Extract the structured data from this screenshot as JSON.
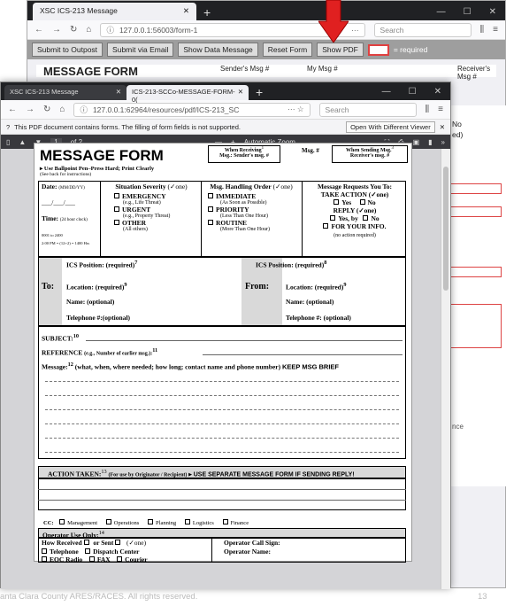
{
  "back_window": {
    "tab_title": "XSC ICS-213 Message",
    "url": "127.0.0.1:56003/form-1",
    "search_placeholder": "Search",
    "buttons": [
      "Submit to Outpost",
      "Submit via Email",
      "Show Data Message",
      "Reset Form",
      "Show PDF"
    ],
    "required_legend": "= required",
    "form_title": "MESSAGE FORM",
    "col_sender": "Sender's Msg #",
    "col_my": "My Msg #",
    "col_receiver": "Receiver's Msg #",
    "sup_sender": "2",
    "sup_receiver": "3",
    "side_no": "No",
    "side_d": "ed)",
    "side_nce": "nce"
  },
  "front_window": {
    "tab1": "XSC ICS-213 Message",
    "tab2": "ICS-213-SCCo-MESSAGE-FORM-0(",
    "url": "127.0.0.1:62964/resources/pdf/ICS-213_SC",
    "search_placeholder": "Search",
    "notice": "This PDF document contains forms. The filling of form fields is not supported.",
    "open_button": "Open With Different Viewer",
    "page_num": "1",
    "page_total": "of 2",
    "zoom": "Automatic Zoom"
  },
  "pdf": {
    "title": "MESSAGE FORM",
    "sub1": "▸ Use Ballpoint Pen–Press Hard; Print Clearly",
    "sub2": "(See back for instructions)",
    "recv_label": "When Receiving",
    "recv_sup": "1",
    "recv_sub": "Msg.: Sender's msg. #",
    "msg_label": "Msg. #",
    "send_label": "When Sending Msg.",
    "send_sup": "3",
    "send_sub": "Receiver's msg. #",
    "date_label": "Date:",
    "date_fmt": "(MM/DD/YY)",
    "date_sup": "4",
    "date_blank": "___/___/___",
    "time_label": "Time:",
    "time_fmt": "(24 hour clock)",
    "time_note1": "0001 to 2400",
    "time_note2": "2:00 PM = (12+2) = 1400 Hrs",
    "sev_title": "Situation Severity",
    "sev_hint": "(✓one)",
    "sev_sup": "4",
    "sev": [
      {
        "l": "EMERGENCY",
        "s": "(e.g., Life Threat)"
      },
      {
        "l": "URGENT",
        "s": "(e.g., Property Threat)"
      },
      {
        "l": "OTHER",
        "s": "(All others)"
      }
    ],
    "hand_title": "Msg. Handling Order",
    "hand_hint": "(✓one)",
    "hand_sup": "5",
    "hand": [
      {
        "l": "IMMEDIATE",
        "s": "(As Soon as Possible)"
      },
      {
        "l": "PRIORITY",
        "s": "(Less Than One Hour)"
      },
      {
        "l": "ROUTINE",
        "s": "(More Than One Hour)"
      }
    ],
    "req_title": "Message Requests You To:",
    "req_sup": "6",
    "req1": "TAKE ACTION (✓one)",
    "req_yes": "Yes",
    "req_no": "No",
    "req2": "REPLY (✓one)",
    "req_yesby": "Yes, by",
    "req3": "FOR YOUR INFO.",
    "req3s": "(no action required)",
    "to_label": "To:",
    "from_label": "From:",
    "ics_to": "ICS Position: (required)",
    "ics_to_sup": "7",
    "ics_from": "ICS Position: (required)",
    "ics_from_sup": "8",
    "loc_to": "Location: (required)",
    "loc_sup": "9",
    "loc_from": "Location: (required)",
    "name": "Name: (optional)",
    "tel_to": "Telephone #:(optional)",
    "tel_from": "Telephone #: (optional)",
    "subject": "SUBJECT:",
    "subject_sup": "10",
    "reference": "REFERENCE",
    "ref_hint": "(e.g., Number of earlier msg.):",
    "ref_sup": "11",
    "message": "Message:",
    "msg_sup": "12",
    "msg_hint": "(what, when, where needed; how long; contact name and phone number)",
    "msg_brief": "KEEP MSG BRIEF",
    "action": "ACTION TAKEN:",
    "action_sup": "13",
    "action_hint": "(For use by Originator / Recipient)",
    "action_note": "▸ USE SEPARATE MESSAGE FORM IF SENDING REPLY!",
    "cc": "CC:",
    "cc_items": [
      "Management",
      "Operations",
      "Planning",
      "Logistics",
      "Finance"
    ],
    "op_only": "Operator Use Only:",
    "op_sup": "14",
    "how_recv": "How Received",
    "or_sent": "or  Sent",
    "one": "(✓one)",
    "op_call": "Operator Call Sign:",
    "op_name": "Operator Name:",
    "methods": [
      [
        "Telephone",
        "Dispatch Center"
      ],
      [
        "EOC Radio",
        "FAX",
        "Courier"
      ]
    ]
  },
  "footer": {
    "copyright": "anta Clara County ARES/RACES.  All rights reserved.",
    "page": "13"
  },
  "colors": {
    "accent_red": "#e02020"
  }
}
